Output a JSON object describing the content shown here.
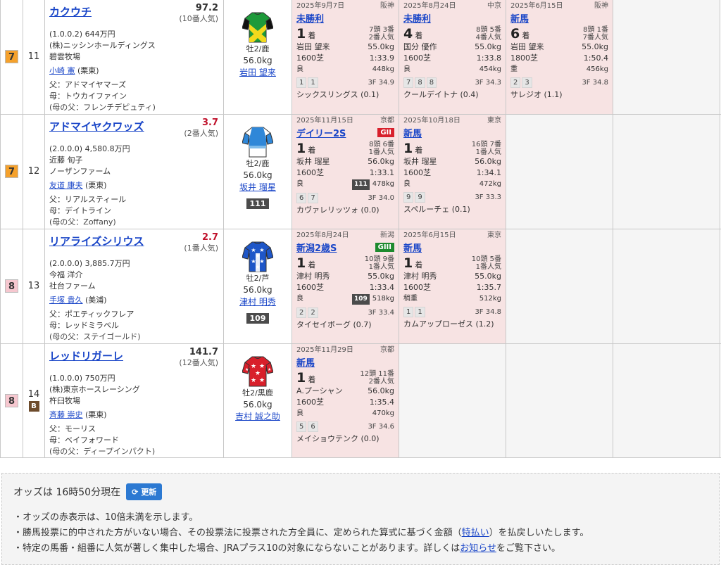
{
  "horses": [
    {
      "waku": "7",
      "waku_color": "#f5a12c",
      "umaban": "11",
      "mark": "",
      "name": "カクウチ",
      "odds": "97.2",
      "odds_red": false,
      "popularity": "(10番人気)",
      "record": "(1.0.0.2)",
      "prize": "644万円",
      "owner": "(株)ニッシンホールディングス",
      "breeder": "碧雲牧場",
      "trainer": "小崎 憲",
      "trainer_region": "(栗東)",
      "sire": "父：アドマイヤマーズ",
      "dam": "母：トウカイファイン",
      "damsire": "(母の父：フレンチデピュティ)",
      "sexage": "牡2/鹿",
      "weight": "56.0kg",
      "jockey": "岩田 望来",
      "index": "",
      "silk": "green-yellow",
      "past": [
        {
          "date": "2025年9月7日",
          "course": "阪神",
          "race": "未勝利",
          "grade": "",
          "rank": "1",
          "rank_suffix": "着",
          "field": "7頭 3番",
          "pop": "2番人気",
          "jockey": "岩田 望来",
          "kg": "55.0kg",
          "dist": "1600芝",
          "time": "1:33.9",
          "ground": "良",
          "sidx": "",
          "bw": "448kg",
          "corners": [
            "1",
            "1"
          ],
          "f3": "3F 34.9",
          "winner": "シックスリングス (0.1)"
        },
        {
          "date": "2025年8月24日",
          "course": "中京",
          "race": "未勝利",
          "grade": "",
          "rank": "4",
          "rank_suffix": "着",
          "field": "8頭 5番",
          "pop": "4番人気",
          "jockey": "国分 優作",
          "kg": "55.0kg",
          "dist": "1600芝",
          "time": "1:33.8",
          "ground": "良",
          "sidx": "",
          "bw": "454kg",
          "corners": [
            "7",
            "8",
            "8"
          ],
          "f3": "3F 34.3",
          "winner": "クールデイトナ (0.4)"
        },
        {
          "date": "2025年6月15日",
          "course": "阪神",
          "race": "新馬",
          "grade": "",
          "rank": "6",
          "rank_suffix": "着",
          "field": "8頭 1番",
          "pop": "7番人気",
          "jockey": "岩田 望来",
          "kg": "55.0kg",
          "dist": "1800芝",
          "time": "1:50.4",
          "ground": "重",
          "sidx": "",
          "bw": "456kg",
          "corners": [
            "2",
            "3"
          ],
          "f3": "3F 34.8",
          "winner": "サレジオ (1.1)"
        }
      ]
    },
    {
      "waku": "7",
      "waku_color": "#f5a12c",
      "umaban": "12",
      "mark": "",
      "name": "アドマイヤクワッズ",
      "odds": "3.7",
      "odds_red": true,
      "popularity": "(2番人気)",
      "record": "(2.0.0.0)",
      "prize": "4,580.8万円",
      "owner": "近藤 旬子",
      "breeder": "ノーザンファーム",
      "trainer": "友道 康夫",
      "trainer_region": "(栗東)",
      "sire": "父：リアルスティール",
      "dam": "母：デイトライン",
      "damsire": "(母の父：Zoffany)",
      "sexage": "牡2/鹿",
      "weight": "56.0kg",
      "jockey": "坂井 瑠星",
      "index": "111",
      "silk": "blue-white",
      "past": [
        {
          "date": "2025年11月15日",
          "course": "京都",
          "race": "デイリー2S",
          "grade": "GII",
          "rank": "1",
          "rank_suffix": "着",
          "field": "8頭 6番",
          "pop": "1番人気",
          "jockey": "坂井 瑠星",
          "kg": "56.0kg",
          "dist": "1600芝",
          "time": "1:33.1",
          "ground": "良",
          "sidx": "111",
          "bw": "478kg",
          "corners": [
            "6",
            "7"
          ],
          "f3": "3F 34.0",
          "winner": "カヴァレリッツォ (0.0)"
        },
        {
          "date": "2025年10月18日",
          "course": "東京",
          "race": "新馬",
          "grade": "",
          "rank": "1",
          "rank_suffix": "着",
          "field": "16頭 7番",
          "pop": "1番人気",
          "jockey": "坂井 瑠星",
          "kg": "56.0kg",
          "dist": "1600芝",
          "time": "1:34.1",
          "ground": "良",
          "sidx": "",
          "bw": "472kg",
          "corners": [
            "9",
            "9"
          ],
          "f3": "3F 33.3",
          "winner": "スペルーチェ (0.1)"
        }
      ]
    },
    {
      "waku": "8",
      "waku_color": "#f6c7cf",
      "umaban": "13",
      "mark": "",
      "name": "リアライズシリウス",
      "odds": "2.7",
      "odds_red": true,
      "popularity": "(1番人気)",
      "record": "(2.0.0.0)",
      "prize": "3,885.7万円",
      "owner": "今福 洋介",
      "breeder": "社台ファーム",
      "trainer": "手塚 貴久",
      "trainer_region": "(美浦)",
      "sire": "父：ポエティックフレア",
      "dam": "母：レッドミラベル",
      "damsire": "(母の父：ステイゴールド)",
      "sexage": "牡2/芦",
      "weight": "56.0kg",
      "jockey": "津村 明秀",
      "index": "109",
      "silk": "blue-stars",
      "past": [
        {
          "date": "2025年8月24日",
          "course": "新潟",
          "race": "新潟2歳S",
          "grade": "GIII",
          "rank": "1",
          "rank_suffix": "着",
          "field": "10頭 9番",
          "pop": "1番人気",
          "jockey": "津村 明秀",
          "kg": "55.0kg",
          "dist": "1600芝",
          "time": "1:33.4",
          "ground": "良",
          "sidx": "109",
          "bw": "518kg",
          "corners": [
            "2",
            "2"
          ],
          "f3": "3F 33.4",
          "winner": "タイセイボーグ (0.7)"
        },
        {
          "date": "2025年6月15日",
          "course": "東京",
          "race": "新馬",
          "grade": "",
          "rank": "1",
          "rank_suffix": "着",
          "field": "10頭 5番",
          "pop": "1番人気",
          "jockey": "津村 明秀",
          "kg": "55.0kg",
          "dist": "1600芝",
          "time": "1:35.7",
          "ground": "稍重",
          "sidx": "",
          "bw": "512kg",
          "corners": [
            "1",
            "1"
          ],
          "f3": "3F 34.8",
          "winner": "カムアップローゼス (1.2)"
        }
      ]
    },
    {
      "waku": "8",
      "waku_color": "#f6c7cf",
      "umaban": "14",
      "mark": "B",
      "name": "レッドリガーレ",
      "odds": "141.7",
      "odds_red": false,
      "popularity": "(12番人気)",
      "record": "(1.0.0.0)",
      "prize": "750万円",
      "owner": "(株)東京ホースレーシング",
      "breeder": "杵臼牧場",
      "trainer": "斉藤 崇史",
      "trainer_region": "(栗東)",
      "sire": "父：モーリス",
      "dam": "母：ベイフォワード",
      "damsire": "(母の父：ディープインパクト)",
      "sexage": "牡2/黒鹿",
      "weight": "56.0kg",
      "jockey": "吉村 誠之助",
      "index": "",
      "silk": "red-stars",
      "past": [
        {
          "date": "2025年11月29日",
          "course": "京都",
          "race": "新馬",
          "grade": "",
          "rank": "1",
          "rank_suffix": "着",
          "field": "12頭 11番",
          "pop": "2番人気",
          "jockey": "A.プーシャン",
          "kg": "56.0kg",
          "dist": "1600芝",
          "time": "1:35.4",
          "ground": "良",
          "sidx": "",
          "bw": "470kg",
          "corners": [
            "5",
            "6"
          ],
          "f3": "3F 34.6",
          "winner": "メイショウテンク (0.0)"
        }
      ]
    }
  ],
  "footer": {
    "odds_time": "オッズは 16時50分現在",
    "refresh_label": "更新",
    "note1": "・オッズの赤表示は、10倍未満を示します。",
    "note2_pre": "・勝馬投票に的中された方がいない場合、その投票法に投票された方全員に、定められた算式に基づく金額（",
    "note2_link": "特払い",
    "note2_post": "）を払戻しいたします。",
    "note3_pre": "・特定の馬番・組番に人気が著しく集中した場合、JRAプラス10の対象にならないことがあります。詳しくは",
    "note3_link": "お知らせ",
    "note3_post": "をご覧下さい。"
  }
}
